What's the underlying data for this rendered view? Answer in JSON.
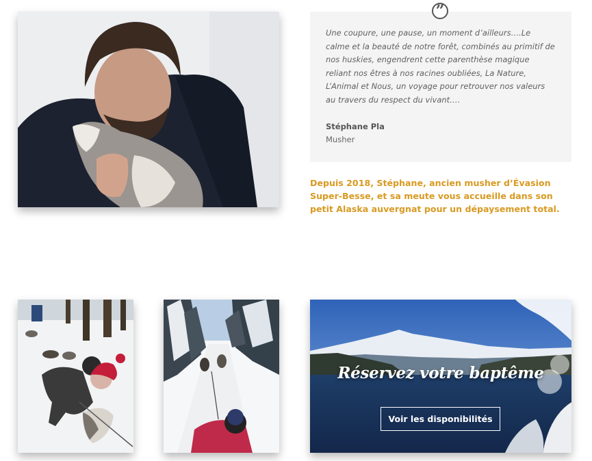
{
  "quote": {
    "icon": "quote-icon",
    "text": "Une coupure, une pause, un moment d’ailleurs….Le calme et la beauté de notre forêt, combinés au primitif de nos huskies, engendrent cette parenthèse magique reliant nos êtres à nos racines oubliées, La Nature, L’Animal et Nous, un voyage pour retrouver nos valeurs au travers du respect du vivant….",
    "author": "Stéphane Pla",
    "role": "Musher"
  },
  "intro": {
    "text": "Depuis 2018, Stéphane, ancien musher d’Évasion Super-Besse, et sa meute vous accueille dans son petit Alaska auvergnat pour un dépaysement total.",
    "color": "#d89a22"
  },
  "booking": {
    "title": "Réservez votre baptême",
    "button_label": "Voir les disponibilités"
  },
  "colors": {
    "card_background": "#f4f4f4",
    "text_gray": "#5f5f5f"
  }
}
